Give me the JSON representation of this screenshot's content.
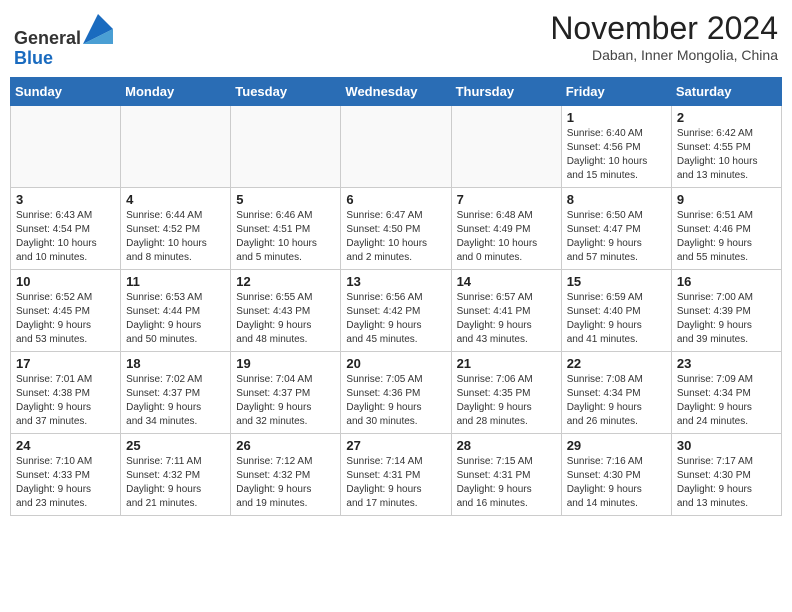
{
  "header": {
    "logo_line1": "General",
    "logo_line2": "Blue",
    "month_title": "November 2024",
    "location": "Daban, Inner Mongolia, China"
  },
  "weekdays": [
    "Sunday",
    "Monday",
    "Tuesday",
    "Wednesday",
    "Thursday",
    "Friday",
    "Saturday"
  ],
  "weeks": [
    [
      {
        "day": "",
        "detail": ""
      },
      {
        "day": "",
        "detail": ""
      },
      {
        "day": "",
        "detail": ""
      },
      {
        "day": "",
        "detail": ""
      },
      {
        "day": "",
        "detail": ""
      },
      {
        "day": "1",
        "detail": "Sunrise: 6:40 AM\nSunset: 4:56 PM\nDaylight: 10 hours\nand 15 minutes."
      },
      {
        "day": "2",
        "detail": "Sunrise: 6:42 AM\nSunset: 4:55 PM\nDaylight: 10 hours\nand 13 minutes."
      }
    ],
    [
      {
        "day": "3",
        "detail": "Sunrise: 6:43 AM\nSunset: 4:54 PM\nDaylight: 10 hours\nand 10 minutes."
      },
      {
        "day": "4",
        "detail": "Sunrise: 6:44 AM\nSunset: 4:52 PM\nDaylight: 10 hours\nand 8 minutes."
      },
      {
        "day": "5",
        "detail": "Sunrise: 6:46 AM\nSunset: 4:51 PM\nDaylight: 10 hours\nand 5 minutes."
      },
      {
        "day": "6",
        "detail": "Sunrise: 6:47 AM\nSunset: 4:50 PM\nDaylight: 10 hours\nand 2 minutes."
      },
      {
        "day": "7",
        "detail": "Sunrise: 6:48 AM\nSunset: 4:49 PM\nDaylight: 10 hours\nand 0 minutes."
      },
      {
        "day": "8",
        "detail": "Sunrise: 6:50 AM\nSunset: 4:47 PM\nDaylight: 9 hours\nand 57 minutes."
      },
      {
        "day": "9",
        "detail": "Sunrise: 6:51 AM\nSunset: 4:46 PM\nDaylight: 9 hours\nand 55 minutes."
      }
    ],
    [
      {
        "day": "10",
        "detail": "Sunrise: 6:52 AM\nSunset: 4:45 PM\nDaylight: 9 hours\nand 53 minutes."
      },
      {
        "day": "11",
        "detail": "Sunrise: 6:53 AM\nSunset: 4:44 PM\nDaylight: 9 hours\nand 50 minutes."
      },
      {
        "day": "12",
        "detail": "Sunrise: 6:55 AM\nSunset: 4:43 PM\nDaylight: 9 hours\nand 48 minutes."
      },
      {
        "day": "13",
        "detail": "Sunrise: 6:56 AM\nSunset: 4:42 PM\nDaylight: 9 hours\nand 45 minutes."
      },
      {
        "day": "14",
        "detail": "Sunrise: 6:57 AM\nSunset: 4:41 PM\nDaylight: 9 hours\nand 43 minutes."
      },
      {
        "day": "15",
        "detail": "Sunrise: 6:59 AM\nSunset: 4:40 PM\nDaylight: 9 hours\nand 41 minutes."
      },
      {
        "day": "16",
        "detail": "Sunrise: 7:00 AM\nSunset: 4:39 PM\nDaylight: 9 hours\nand 39 minutes."
      }
    ],
    [
      {
        "day": "17",
        "detail": "Sunrise: 7:01 AM\nSunset: 4:38 PM\nDaylight: 9 hours\nand 37 minutes."
      },
      {
        "day": "18",
        "detail": "Sunrise: 7:02 AM\nSunset: 4:37 PM\nDaylight: 9 hours\nand 34 minutes."
      },
      {
        "day": "19",
        "detail": "Sunrise: 7:04 AM\nSunset: 4:37 PM\nDaylight: 9 hours\nand 32 minutes."
      },
      {
        "day": "20",
        "detail": "Sunrise: 7:05 AM\nSunset: 4:36 PM\nDaylight: 9 hours\nand 30 minutes."
      },
      {
        "day": "21",
        "detail": "Sunrise: 7:06 AM\nSunset: 4:35 PM\nDaylight: 9 hours\nand 28 minutes."
      },
      {
        "day": "22",
        "detail": "Sunrise: 7:08 AM\nSunset: 4:34 PM\nDaylight: 9 hours\nand 26 minutes."
      },
      {
        "day": "23",
        "detail": "Sunrise: 7:09 AM\nSunset: 4:34 PM\nDaylight: 9 hours\nand 24 minutes."
      }
    ],
    [
      {
        "day": "24",
        "detail": "Sunrise: 7:10 AM\nSunset: 4:33 PM\nDaylight: 9 hours\nand 23 minutes."
      },
      {
        "day": "25",
        "detail": "Sunrise: 7:11 AM\nSunset: 4:32 PM\nDaylight: 9 hours\nand 21 minutes."
      },
      {
        "day": "26",
        "detail": "Sunrise: 7:12 AM\nSunset: 4:32 PM\nDaylight: 9 hours\nand 19 minutes."
      },
      {
        "day": "27",
        "detail": "Sunrise: 7:14 AM\nSunset: 4:31 PM\nDaylight: 9 hours\nand 17 minutes."
      },
      {
        "day": "28",
        "detail": "Sunrise: 7:15 AM\nSunset: 4:31 PM\nDaylight: 9 hours\nand 16 minutes."
      },
      {
        "day": "29",
        "detail": "Sunrise: 7:16 AM\nSunset: 4:30 PM\nDaylight: 9 hours\nand 14 minutes."
      },
      {
        "day": "30",
        "detail": "Sunrise: 7:17 AM\nSunset: 4:30 PM\nDaylight: 9 hours\nand 13 minutes."
      }
    ]
  ]
}
